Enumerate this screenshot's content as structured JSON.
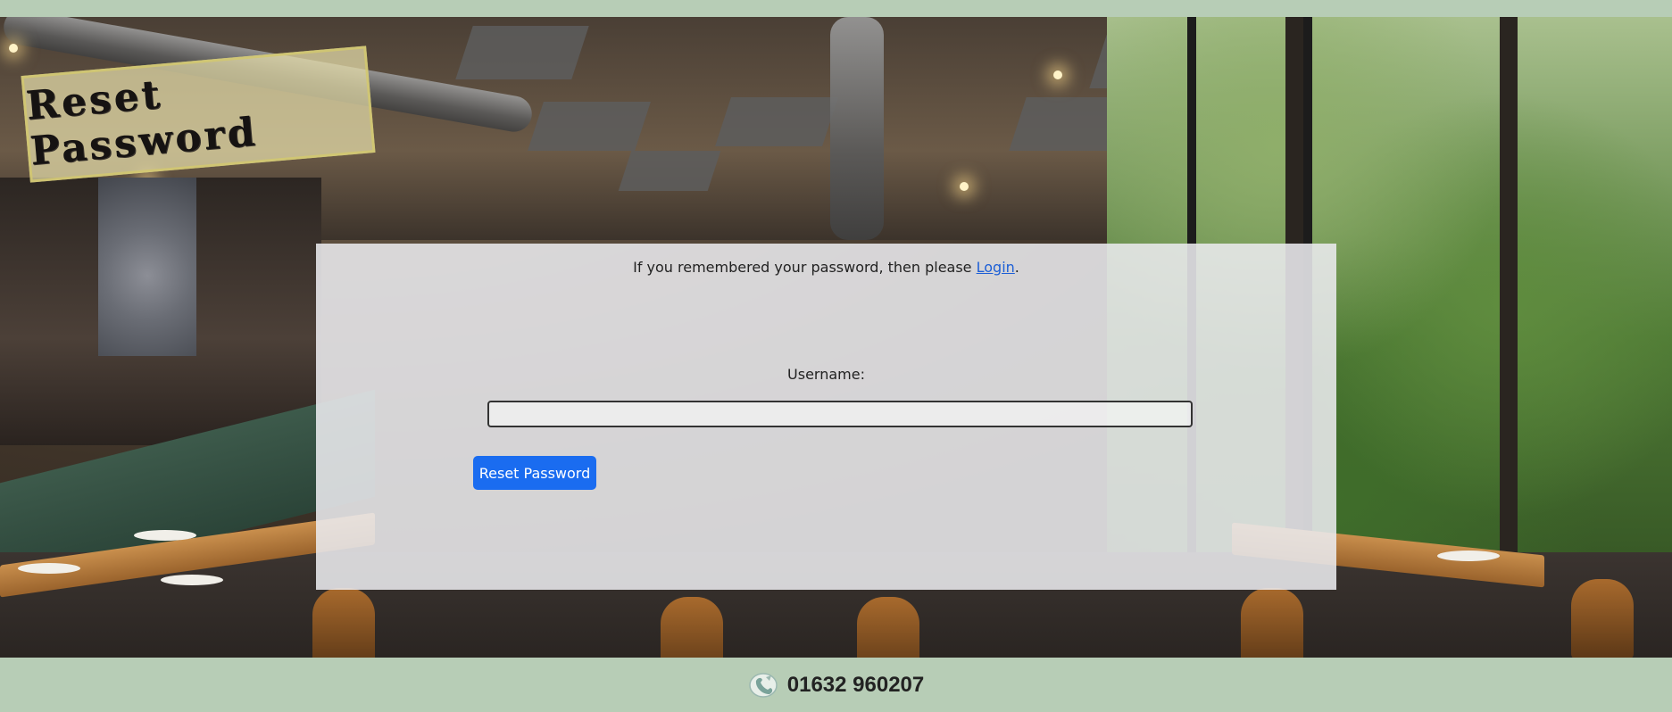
{
  "banner": {
    "title": "Reset Password"
  },
  "card": {
    "login_prompt": "If you remembered your password, then please",
    "login_link": "Login",
    "login_suffix": ".",
    "username_label": "Username:",
    "username_value": "",
    "reset_button": "Reset Password"
  },
  "footer": {
    "phone": "01632 960207",
    "icon": "phone-icon"
  },
  "colors": {
    "band": "#b7cdb6",
    "button": "#1a6cf0",
    "link": "#1d5fd6"
  }
}
